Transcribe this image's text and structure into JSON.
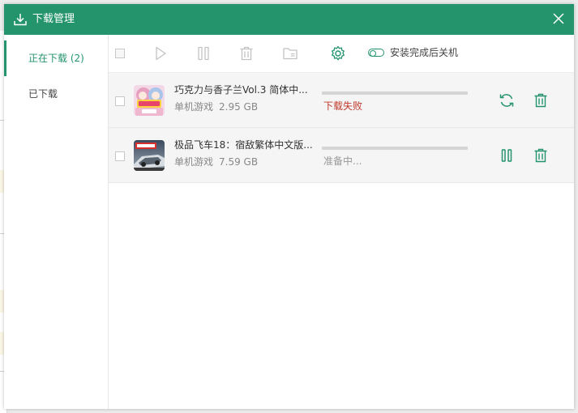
{
  "window": {
    "title": "下载管理"
  },
  "sidebar": {
    "items": [
      {
        "label": "正在下载 (2)",
        "active": true
      },
      {
        "label": "已下载",
        "active": false
      }
    ]
  },
  "toolbar": {
    "buttons": [
      "select-all-checkbox",
      "play-icon",
      "pause-icon",
      "trash-icon",
      "folder-icon",
      "gear-icon"
    ],
    "shutdown_toggle_label": "安装完成后关机",
    "shutdown_toggle_on": false
  },
  "downloads": [
    {
      "title": "巧克力与香子兰Vol.3 简体中...",
      "category": "单机游戏",
      "size": "2.95 GB",
      "progress": 0,
      "status": "下载失败",
      "status_color": "#c0392b",
      "action_icon": "retry-icon"
    },
    {
      "title": "极品飞车18：宿敌繁体中文版...",
      "category": "单机游戏",
      "size": "7.59 GB",
      "progress": 0,
      "status": "准备中...",
      "status_color": "#999999",
      "action_icon": "pause-icon"
    }
  ],
  "colors": {
    "accent": "#24946d",
    "title_bar": "#24946d",
    "error": "#c0392b"
  }
}
